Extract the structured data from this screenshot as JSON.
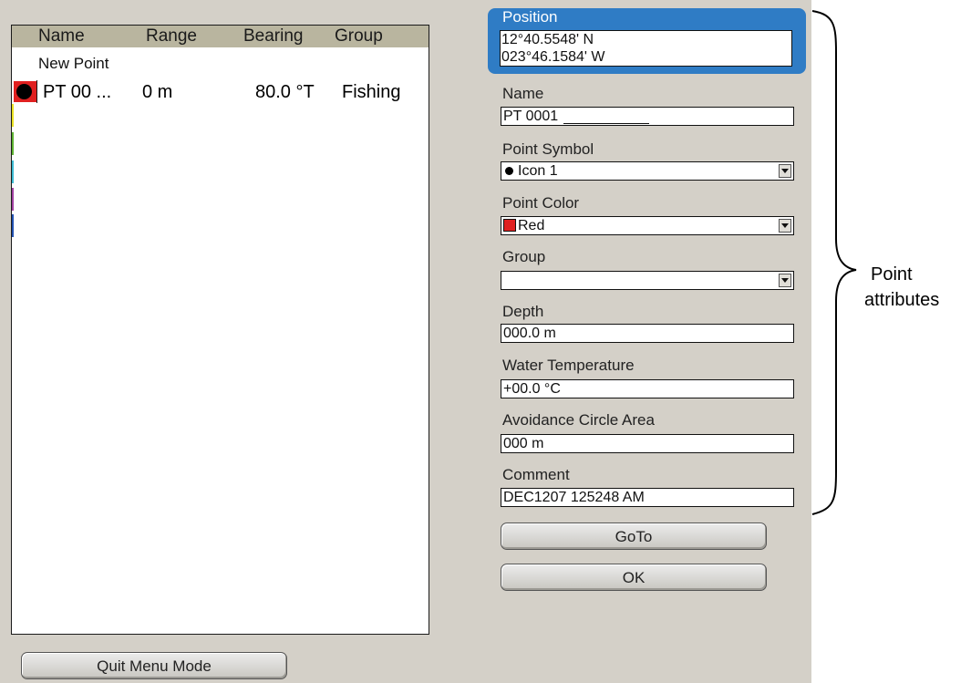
{
  "list": {
    "columns": [
      "Name",
      "Range",
      "Bearing",
      "Group"
    ],
    "new_point": "New Point",
    "rows": [
      {
        "name": "PT 00 ...",
        "range": "0 m",
        "bearing": "80.0 °T",
        "group": "Fishing",
        "color": "#e02020"
      }
    ]
  },
  "buttons": {
    "quit": "Quit Menu Mode",
    "goto": "GoTo",
    "ok": "OK"
  },
  "form": {
    "position": {
      "label": "Position",
      "lat": "12°40.5548' N",
      "lon": "023°46.1584' W"
    },
    "name": {
      "label": "Name",
      "value": "PT 0001"
    },
    "symbol": {
      "label": "Point Symbol",
      "value": "Icon 1"
    },
    "color": {
      "label": "Point Color",
      "value": "Red",
      "swatch": "#e02020"
    },
    "group": {
      "label": "Group",
      "value": ""
    },
    "depth": {
      "label": "Depth",
      "value": "000.0 m"
    },
    "water_temp": {
      "label": "Water Temperature",
      "value": "+00.0 °C"
    },
    "avoidance": {
      "label": "Avoidance Circle Area",
      "value": "000 m"
    },
    "comment": {
      "label": "Comment",
      "value": "DEC1207 125248 AM"
    }
  },
  "annotation": {
    "line1": "Point",
    "line2": "attributes"
  },
  "colors": {
    "panel_bg": "#d4d0c8",
    "header_bg": "#b9b59f",
    "position_highlight": "#2f7cc5",
    "row_bands": [
      "#e8e020",
      "#5cb030",
      "#3ab8d0",
      "#a040a0",
      "#2050b0"
    ]
  }
}
